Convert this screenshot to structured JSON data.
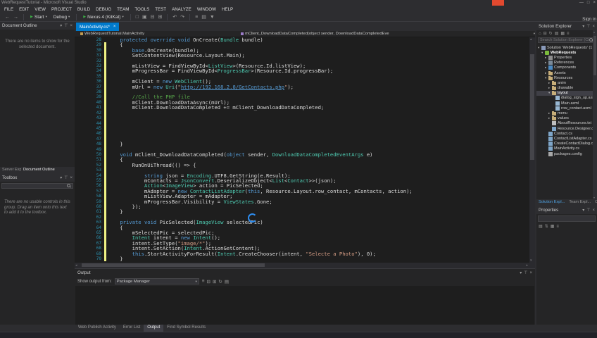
{
  "colors": {
    "accent": "#007ACC",
    "chrome_bg": "#2D2D30",
    "panel_bg": "#252526",
    "editor_bg": "#1E1E1E",
    "keyword": "#569CD6",
    "type": "#4EC9B0",
    "string": "#D69D85",
    "comment": "#57A64A",
    "line_number": "#2B91AF",
    "change_bar": "#EFF284",
    "record_red": "#E2492F",
    "selection": "#3F3F46"
  },
  "window": {
    "title": "WebRequestTutorial - Microsoft Visual Studio",
    "sign_in": "Sign in",
    "controls": [
      {
        "glyph": "—",
        "name": "minimize-button"
      },
      {
        "glyph": "□",
        "name": "maximize-button"
      },
      {
        "glyph": "×",
        "name": "close-button"
      }
    ]
  },
  "menu": {
    "items": [
      "FILE",
      "EDIT",
      "VIEW",
      "PROJECT",
      "BUILD",
      "DEBUG",
      "TEAM",
      "TOOLS",
      "TEST",
      "ANALYZE",
      "WINDOW",
      "HELP"
    ]
  },
  "toolbar": {
    "nav_icons": [
      {
        "glyph": "←",
        "name": "navigate-back-icon"
      },
      {
        "glyph": "→",
        "name": "navigate-forward-icon"
      }
    ],
    "start_label": "Start",
    "config_label": "Debug",
    "device_label": "Nexus 4 (KitKat)",
    "icon_groups": [
      [
        {
          "glyph": "□",
          "name": "new-project-icon"
        },
        {
          "glyph": "▣",
          "name": "open-file-icon"
        },
        {
          "glyph": "⊟",
          "name": "save-icon"
        },
        {
          "glyph": "⊞",
          "name": "save-all-icon"
        }
      ],
      [
        {
          "glyph": "↶",
          "name": "undo-icon"
        },
        {
          "glyph": "↷",
          "name": "redo-icon"
        }
      ],
      [
        {
          "glyph": "≡",
          "name": "comment-icon"
        },
        {
          "glyph": "▤",
          "name": "uncomment-icon"
        },
        {
          "glyph": "▼",
          "name": "more-options-icon"
        }
      ]
    ]
  },
  "panel_header_icons": [
    {
      "glyph": "▾",
      "name": "window-position-icon"
    },
    {
      "glyph": "⊤",
      "name": "pin-icon"
    },
    {
      "glyph": "×",
      "name": "close-icon"
    }
  ],
  "left_dock": {
    "outline": {
      "title": "Document Outline",
      "message": "There are no items to show for the selected document."
    },
    "tabs": [
      {
        "label": "Server Explorer",
        "active": false
      },
      {
        "label": "Document Outline",
        "active": true
      }
    ],
    "toolbox": {
      "title": "Toolbox",
      "message": "There are no usable controls in this group. Drag an item onto this text to add it to the toolbox."
    }
  },
  "editor": {
    "tab": {
      "label": "MainActivity.cs*",
      "close": "×"
    },
    "breadcrumb": {
      "left": "WebRequestTutorial.MainActivity",
      "right": "mClient_DownloadDataCompleted(object sender, DownloadDataCompletedEve"
    },
    "lines": [
      {
        "n": 28,
        "chg": false,
        "segs": [
          [
            "p",
            "    "
          ],
          [
            "k",
            "protected"
          ],
          [
            "p",
            " "
          ],
          [
            "k",
            "override"
          ],
          [
            "p",
            " "
          ],
          [
            "k",
            "void"
          ],
          [
            "p",
            " OnCreate("
          ],
          [
            "t",
            "Bundle"
          ],
          [
            "p",
            " bundle)"
          ]
        ]
      },
      {
        "n": 29,
        "chg": true,
        "segs": [
          [
            "p",
            "    {"
          ]
        ]
      },
      {
        "n": 30,
        "chg": true,
        "segs": [
          [
            "p",
            "        "
          ],
          [
            "k",
            "base"
          ],
          [
            "p",
            ".OnCreate(bundle);"
          ]
        ]
      },
      {
        "n": 31,
        "chg": true,
        "segs": [
          [
            "p",
            "        SetContentView(Resource.Layout.Main);"
          ]
        ]
      },
      {
        "n": 32,
        "chg": true,
        "segs": []
      },
      {
        "n": 33,
        "chg": true,
        "segs": [
          [
            "p",
            "        mListView = FindViewById<"
          ],
          [
            "t",
            "ListView"
          ],
          [
            "p",
            ">(Resource.Id.listView);"
          ]
        ]
      },
      {
        "n": 34,
        "chg": true,
        "segs": [
          [
            "p",
            "        mProgressBar = FindViewById<"
          ],
          [
            "t",
            "ProgressBar"
          ],
          [
            "p",
            ">(Resource.Id.progressBar);"
          ]
        ]
      },
      {
        "n": 35,
        "chg": true,
        "segs": []
      },
      {
        "n": 36,
        "chg": true,
        "segs": [
          [
            "p",
            "        mClient = "
          ],
          [
            "k",
            "new"
          ],
          [
            "p",
            " "
          ],
          [
            "t",
            "WebClient"
          ],
          [
            "p",
            "();"
          ]
        ]
      },
      {
        "n": 37,
        "chg": true,
        "segs": [
          [
            "p",
            "        mUrl = "
          ],
          [
            "k",
            "new"
          ],
          [
            "p",
            " "
          ],
          [
            "t",
            "Uri"
          ],
          [
            "p",
            "("
          ],
          [
            "s",
            "\""
          ],
          [
            "u",
            "http://192.168.2.8/GetContacts.php"
          ],
          [
            "s",
            "\""
          ],
          [
            "p",
            ");"
          ]
        ]
      },
      {
        "n": 38,
        "chg": true,
        "segs": []
      },
      {
        "n": 39,
        "chg": true,
        "segs": [
          [
            "p",
            "        "
          ],
          [
            "c",
            "//Call the PHP file"
          ]
        ]
      },
      {
        "n": 40,
        "chg": true,
        "segs": [
          [
            "p",
            "        mClient.DownloadDataAsync(mUrl);"
          ]
        ]
      },
      {
        "n": 41,
        "chg": true,
        "segs": [
          [
            "p",
            "        mClient.DownloadDataCompleted += mClient_DownloadDataCompleted;"
          ]
        ]
      },
      {
        "n": 42,
        "chg": true,
        "segs": []
      },
      {
        "n": 43,
        "chg": true,
        "segs": []
      },
      {
        "n": 44,
        "chg": true,
        "segs": []
      },
      {
        "n": 45,
        "chg": true,
        "segs": []
      },
      {
        "n": 46,
        "chg": true,
        "segs": []
      },
      {
        "n": 47,
        "chg": true,
        "segs": []
      },
      {
        "n": 48,
        "chg": true,
        "segs": [
          [
            "p",
            "    }"
          ]
        ]
      },
      {
        "n": 49,
        "chg": true,
        "segs": []
      },
      {
        "n": 50,
        "chg": true,
        "segs": [
          [
            "p",
            "    "
          ],
          [
            "k",
            "void"
          ],
          [
            "p",
            " mClient_DownloadDataCompleted("
          ],
          [
            "k",
            "object"
          ],
          [
            "p",
            " sender, "
          ],
          [
            "t",
            "DownloadDataCompletedEventArgs"
          ],
          [
            "p",
            " e)"
          ]
        ]
      },
      {
        "n": 51,
        "chg": true,
        "segs": [
          [
            "p",
            "    {"
          ]
        ]
      },
      {
        "n": 52,
        "chg": true,
        "segs": [
          [
            "p",
            "        RunOnUiThread(() => {"
          ]
        ]
      },
      {
        "n": 53,
        "chg": true,
        "segs": []
      },
      {
        "n": 54,
        "chg": true,
        "segs": [
          [
            "p",
            "            "
          ],
          [
            "k",
            "string"
          ],
          [
            "p",
            " json = "
          ],
          [
            "t",
            "Encoding"
          ],
          [
            "p",
            ".UTF8.GetString(e.Result);"
          ]
        ]
      },
      {
        "n": 55,
        "chg": true,
        "segs": [
          [
            "p",
            "            mContacts = "
          ],
          [
            "t",
            "JsonConvert"
          ],
          [
            "p",
            ".DeserializeObject<"
          ],
          [
            "t",
            "List"
          ],
          [
            "p",
            "<"
          ],
          [
            "t",
            "Contact"
          ],
          [
            "p",
            ">>(json);"
          ]
        ]
      },
      {
        "n": 56,
        "chg": true,
        "segs": [
          [
            "p",
            "            "
          ],
          [
            "t",
            "Action"
          ],
          [
            "p",
            "<"
          ],
          [
            "t",
            "ImageView"
          ],
          [
            "p",
            "> action = PicSelected;"
          ]
        ]
      },
      {
        "n": 57,
        "chg": true,
        "segs": [
          [
            "p",
            "            mAdapter = "
          ],
          [
            "k",
            "new"
          ],
          [
            "p",
            " "
          ],
          [
            "t",
            "ContactListAdapter"
          ],
          [
            "p",
            "("
          ],
          [
            "k",
            "this"
          ],
          [
            "p",
            ", Resource.Layout.row_contact, mContacts, action);"
          ]
        ]
      },
      {
        "n": 58,
        "chg": true,
        "segs": [
          [
            "p",
            "            mListView.Adapter = mAdapter;"
          ]
        ]
      },
      {
        "n": 59,
        "chg": true,
        "segs": [
          [
            "p",
            "            mProgressBar.Visibility = "
          ],
          [
            "t",
            "ViewStates"
          ],
          [
            "p",
            ".Gone;"
          ]
        ]
      },
      {
        "n": 60,
        "chg": true,
        "segs": [
          [
            "p",
            "        });"
          ]
        ]
      },
      {
        "n": 61,
        "chg": true,
        "segs": [
          [
            "p",
            "    }"
          ]
        ]
      },
      {
        "n": 62,
        "chg": true,
        "segs": []
      },
      {
        "n": 63,
        "chg": true,
        "segs": [
          [
            "p",
            "    "
          ],
          [
            "k",
            "private"
          ],
          [
            "p",
            " "
          ],
          [
            "k",
            "void"
          ],
          [
            "p",
            " PicSelected("
          ],
          [
            "t",
            "ImageView"
          ],
          [
            "p",
            " selectedPic)"
          ]
        ]
      },
      {
        "n": 64,
        "chg": true,
        "segs": [
          [
            "p",
            "    {"
          ]
        ]
      },
      {
        "n": 65,
        "chg": true,
        "segs": [
          [
            "p",
            "        mSelectedPic = selectedPic;"
          ]
        ]
      },
      {
        "n": 66,
        "chg": true,
        "segs": [
          [
            "p",
            "        "
          ],
          [
            "t",
            "Intent"
          ],
          [
            "p",
            " intent = "
          ],
          [
            "k",
            "new"
          ],
          [
            "p",
            " "
          ],
          [
            "t",
            "Intent"
          ],
          [
            "p",
            "();"
          ]
        ]
      },
      {
        "n": 67,
        "chg": true,
        "segs": [
          [
            "p",
            "        intent.SetType("
          ],
          [
            "s",
            "\"image/*\""
          ],
          [
            "p",
            ");"
          ]
        ]
      },
      {
        "n": 68,
        "chg": true,
        "segs": [
          [
            "p",
            "        intent.SetAction("
          ],
          [
            "t",
            "Intent"
          ],
          [
            "p",
            ".ActionGetContent);"
          ]
        ]
      },
      {
        "n": 69,
        "chg": true,
        "segs": [
          [
            "p",
            "        "
          ],
          [
            "k",
            "this"
          ],
          [
            "p",
            ".StartActivityForResult("
          ],
          [
            "t",
            "Intent"
          ],
          [
            "p",
            ".CreateChooser(intent, "
          ],
          [
            "s",
            "\"Selecte a Photo\""
          ],
          [
            "p",
            "), 0);"
          ]
        ]
      },
      {
        "n": 70,
        "chg": true,
        "segs": [
          [
            "p",
            "    }"
          ]
        ]
      }
    ]
  },
  "solution_explorer": {
    "title": "Solution Explorer",
    "toolbar_icons": [
      {
        "glyph": "⌂",
        "name": "home-icon"
      },
      {
        "glyph": "⊟",
        "name": "collapse-all-icon"
      },
      {
        "glyph": "↻",
        "name": "refresh-icon"
      },
      {
        "glyph": "▤",
        "name": "show-all-files-icon"
      },
      {
        "glyph": "▦",
        "name": "view-code-icon"
      },
      {
        "glyph": "≡",
        "name": "properties-icon"
      }
    ],
    "search_placeholder": "Search Solution Explorer (Ctrl+;)",
    "tree": [
      {
        "label": "Solution 'WebRequests' (1 project)",
        "indent": 0,
        "icon": "solution",
        "expand": "open"
      },
      {
        "label": "WebRequests",
        "indent": 1,
        "icon": "project",
        "expand": "open",
        "bold": true
      },
      {
        "label": "Properties",
        "indent": 2,
        "icon": "properties",
        "expand": "closed"
      },
      {
        "label": "References",
        "indent": 2,
        "icon": "references",
        "expand": "closed"
      },
      {
        "label": "Components",
        "indent": 2,
        "icon": "components",
        "expand": "closed"
      },
      {
        "label": "Assets",
        "indent": 2,
        "icon": "folder",
        "expand": "closed"
      },
      {
        "label": "Resources",
        "indent": 2,
        "icon": "folder",
        "expand": "open"
      },
      {
        "label": "anim",
        "indent": 3,
        "icon": "folder",
        "expand": "closed"
      },
      {
        "label": "drawable",
        "indent": 3,
        "icon": "folder",
        "expand": "closed"
      },
      {
        "label": "layout",
        "indent": 3,
        "icon": "folder",
        "expand": "open",
        "selected": true
      },
      {
        "label": "dialog_sign_up.axml",
        "indent": 4,
        "icon": "axml"
      },
      {
        "label": "Main.axml",
        "indent": 4,
        "icon": "axml"
      },
      {
        "label": "row_contact.axml",
        "indent": 4,
        "icon": "axml"
      },
      {
        "label": "menu",
        "indent": 3,
        "icon": "folder",
        "expand": "closed"
      },
      {
        "label": "values",
        "indent": 3,
        "icon": "folder",
        "expand": "closed"
      },
      {
        "label": "AboutResources.txt",
        "indent": 3,
        "icon": "txt"
      },
      {
        "label": "Resource.Designer.cs",
        "indent": 3,
        "icon": "cs"
      },
      {
        "label": "Contact.cs",
        "indent": 2,
        "icon": "cs"
      },
      {
        "label": "ContactListAdapter.cs",
        "indent": 2,
        "icon": "cs"
      },
      {
        "label": "CreateContactDialog.cs",
        "indent": 2,
        "icon": "cs"
      },
      {
        "label": "MainActivity.cs",
        "indent": 2,
        "icon": "cs"
      },
      {
        "label": "packages.config",
        "indent": 2,
        "icon": "config"
      }
    ],
    "tabs": [
      {
        "label": "Solution Expl...",
        "active": true
      },
      {
        "label": "Team Expl...",
        "active": false
      },
      {
        "label": "Cla...",
        "active": false
      }
    ]
  },
  "properties": {
    "title": "Properties",
    "toolbar_icons": [
      {
        "glyph": "▤",
        "name": "categorized-icon"
      },
      {
        "glyph": "⇅",
        "name": "alphabetical-icon"
      },
      {
        "glyph": "▦",
        "name": "properties-icon"
      },
      {
        "glyph": "≡",
        "name": "events-icon"
      }
    ]
  },
  "output": {
    "title": "Output",
    "label": "Show output from:",
    "source": "Package Manager",
    "toolbar_icons": [
      {
        "glyph": "≡",
        "name": "messages-icon"
      },
      {
        "glyph": "⊟",
        "name": "collapse-icon"
      },
      {
        "glyph": "⊞",
        "name": "expand-icon"
      },
      {
        "glyph": "↻",
        "name": "clear-all-icon"
      },
      {
        "glyph": "▤",
        "name": "word-wrap-icon"
      }
    ]
  },
  "bottom_tabs": [
    {
      "label": "Web Publish Activity",
      "active": false
    },
    {
      "label": "Error List",
      "active": false
    },
    {
      "label": "Output",
      "active": true
    },
    {
      "label": "Find Symbol Results",
      "active": false
    }
  ]
}
